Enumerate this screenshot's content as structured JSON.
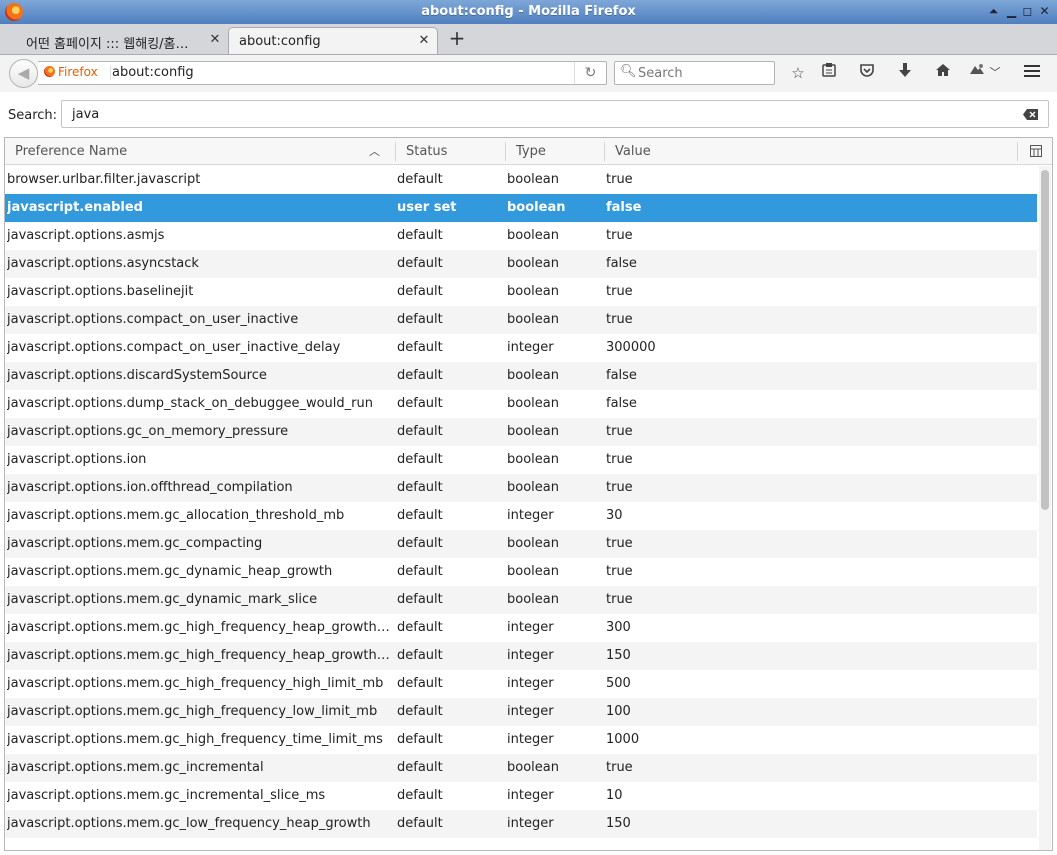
{
  "window": {
    "title": "about:config - Mozilla Firefox"
  },
  "tabs": [
    {
      "label": "어떤 홈페이지 ::: 웹해킹/홈페…",
      "active": false
    },
    {
      "label": "about:config",
      "active": true
    }
  ],
  "navbar": {
    "identity_label": "Firefox",
    "url": "about:config",
    "search_placeholder": "Search"
  },
  "filter": {
    "label": "Search:",
    "value": "java"
  },
  "columns": {
    "name": "Preference Name",
    "status": "Status",
    "type": "Type",
    "value": "Value"
  },
  "selected_index": 1,
  "colors": {
    "selection": "#3399dd",
    "firefox_orange": "#e66000"
  },
  "preferences": [
    {
      "name": "browser.urlbar.filter.javascript",
      "status": "default",
      "type": "boolean",
      "value": "true"
    },
    {
      "name": "javascript.enabled",
      "status": "user set",
      "type": "boolean",
      "value": "false"
    },
    {
      "name": "javascript.options.asmjs",
      "status": "default",
      "type": "boolean",
      "value": "true"
    },
    {
      "name": "javascript.options.asyncstack",
      "status": "default",
      "type": "boolean",
      "value": "false"
    },
    {
      "name": "javascript.options.baselinejit",
      "status": "default",
      "type": "boolean",
      "value": "true"
    },
    {
      "name": "javascript.options.compact_on_user_inactive",
      "status": "default",
      "type": "boolean",
      "value": "true"
    },
    {
      "name": "javascript.options.compact_on_user_inactive_delay",
      "status": "default",
      "type": "integer",
      "value": "300000"
    },
    {
      "name": "javascript.options.discardSystemSource",
      "status": "default",
      "type": "boolean",
      "value": "false"
    },
    {
      "name": "javascript.options.dump_stack_on_debuggee_would_run",
      "status": "default",
      "type": "boolean",
      "value": "false"
    },
    {
      "name": "javascript.options.gc_on_memory_pressure",
      "status": "default",
      "type": "boolean",
      "value": "true"
    },
    {
      "name": "javascript.options.ion",
      "status": "default",
      "type": "boolean",
      "value": "true"
    },
    {
      "name": "javascript.options.ion.offthread_compilation",
      "status": "default",
      "type": "boolean",
      "value": "true"
    },
    {
      "name": "javascript.options.mem.gc_allocation_threshold_mb",
      "status": "default",
      "type": "integer",
      "value": "30"
    },
    {
      "name": "javascript.options.mem.gc_compacting",
      "status": "default",
      "type": "boolean",
      "value": "true"
    },
    {
      "name": "javascript.options.mem.gc_dynamic_heap_growth",
      "status": "default",
      "type": "boolean",
      "value": "true"
    },
    {
      "name": "javascript.options.mem.gc_dynamic_mark_slice",
      "status": "default",
      "type": "boolean",
      "value": "true"
    },
    {
      "name": "javascript.options.mem.gc_high_frequency_heap_growth…",
      "status": "default",
      "type": "integer",
      "value": "300"
    },
    {
      "name": "javascript.options.mem.gc_high_frequency_heap_growth…",
      "status": "default",
      "type": "integer",
      "value": "150"
    },
    {
      "name": "javascript.options.mem.gc_high_frequency_high_limit_mb",
      "status": "default",
      "type": "integer",
      "value": "500"
    },
    {
      "name": "javascript.options.mem.gc_high_frequency_low_limit_mb",
      "status": "default",
      "type": "integer",
      "value": "100"
    },
    {
      "name": "javascript.options.mem.gc_high_frequency_time_limit_ms",
      "status": "default",
      "type": "integer",
      "value": "1000"
    },
    {
      "name": "javascript.options.mem.gc_incremental",
      "status": "default",
      "type": "boolean",
      "value": "true"
    },
    {
      "name": "javascript.options.mem.gc_incremental_slice_ms",
      "status": "default",
      "type": "integer",
      "value": "10"
    },
    {
      "name": "javascript.options.mem.gc_low_frequency_heap_growth",
      "status": "default",
      "type": "integer",
      "value": "150"
    }
  ]
}
